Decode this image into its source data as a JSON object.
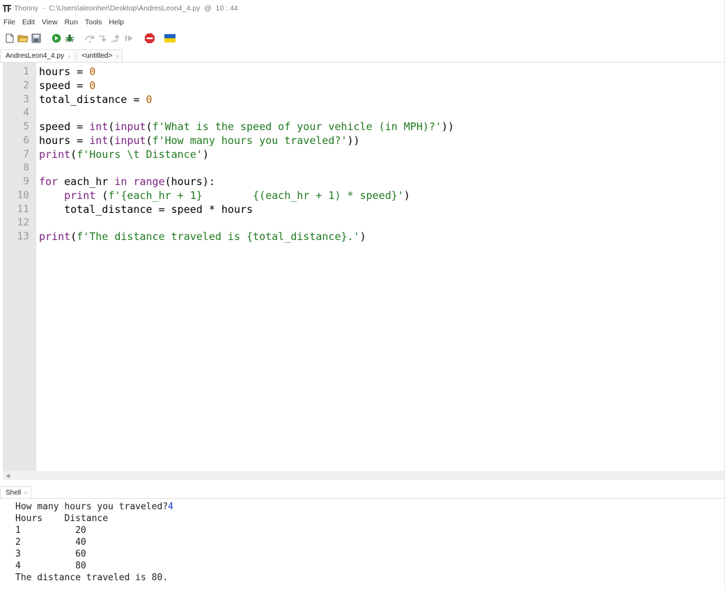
{
  "window": {
    "title": "Thonny  -  C:\\Users\\aleonher\\Desktop\\AndresLeon4_4.py  @  10 : 44"
  },
  "menu": [
    "File",
    "Edit",
    "View",
    "Run",
    "Tools",
    "Help"
  ],
  "toolbar": {
    "icons": [
      "new-file-icon",
      "open-file-icon",
      "save-icon",
      "run-icon",
      "debug-icon",
      "step-over-icon",
      "step-into-icon",
      "step-out-icon",
      "resume-icon",
      "stop-icon",
      "ukraine-flag-icon"
    ]
  },
  "editor_tabs": [
    {
      "label": "AndresLeon4_4.py",
      "close": "×"
    },
    {
      "label": "<untitled>",
      "close": "×"
    }
  ],
  "code": {
    "line_numbers": [
      "1",
      "2",
      "3",
      "4",
      "5",
      "6",
      "7",
      "8",
      "9",
      "10",
      "11",
      "12",
      "13"
    ],
    "lines": [
      "hours = 0",
      "speed = 0",
      "total_distance = 0",
      "",
      "speed = int(input(f'What is the speed of your vehicle (in MPH)?'))",
      "hours = int(input(f'How many hours you traveled?'))",
      "print(f'Hours \\t Distance')",
      "",
      "for each_hr in range(hours):",
      "    print (f'{each_hr + 1}        {(each_hr + 1) * speed}')",
      "    total_distance = speed * hours",
      "",
      "print(f'The distance traveled is {total_distance}.')"
    ]
  },
  "shell": {
    "tab_label": "Shell",
    "tab_close": "×",
    "prompt": "How many hours you traveled?",
    "user_input": "4",
    "header": "Hours    Distance",
    "rows": [
      {
        "hour": "1",
        "distance": "20"
      },
      {
        "hour": "2",
        "distance": "40"
      },
      {
        "hour": "3",
        "distance": "60"
      },
      {
        "hour": "4",
        "distance": "80"
      }
    ],
    "result": "The distance traveled is 80."
  },
  "colors": {
    "keyword": "#7a1f7f",
    "string": "#1f7a1f",
    "number": "#b55a00",
    "shell_input": "#1a3bd6"
  }
}
